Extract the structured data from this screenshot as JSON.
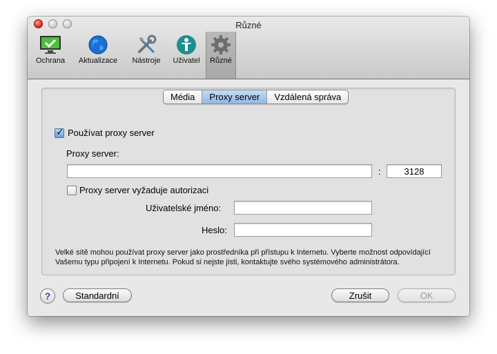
{
  "window": {
    "title": "Různé"
  },
  "toolbar": {
    "items": [
      {
        "label": "Ochrana",
        "icon": "shield-monitor-icon"
      },
      {
        "label": "Aktualizace",
        "icon": "globe-icon"
      },
      {
        "label": "Nástroje",
        "icon": "tools-icon"
      },
      {
        "label": "Uživatel",
        "icon": "user-icon"
      },
      {
        "label": "Různé",
        "icon": "gear-icon",
        "selected": true
      }
    ]
  },
  "tabs": [
    {
      "label": "Média",
      "selected": false
    },
    {
      "label": "Proxy server",
      "selected": true
    },
    {
      "label": "Vzdálená správa",
      "selected": false
    }
  ],
  "proxy": {
    "use_proxy_label": "Používat proxy server",
    "use_proxy_checked": true,
    "server_label": "Proxy server:",
    "server_value": "",
    "port_separator": ":",
    "port_value": "3128",
    "auth_label": "Proxy server vyžaduje autorizaci",
    "auth_checked": false,
    "username_label": "Uživatelské jméno:",
    "username_value": "",
    "password_label": "Heslo:",
    "password_value": "",
    "note": "Velké sítě mohou používat proxy server jako prostředníka při přístupu k Internetu. Vyberte možnost odpovídající Vašemu typu připojení k Internetu. Pokud si nejste jisti, kontaktujte svého systémového administrátora."
  },
  "footer": {
    "help_label": "?",
    "default_label": "Standardní",
    "cancel_label": "Zrušit",
    "ok_label": "OK"
  },
  "colors": {
    "accent": "#8fb8e6",
    "help": "#6b2ea0"
  }
}
